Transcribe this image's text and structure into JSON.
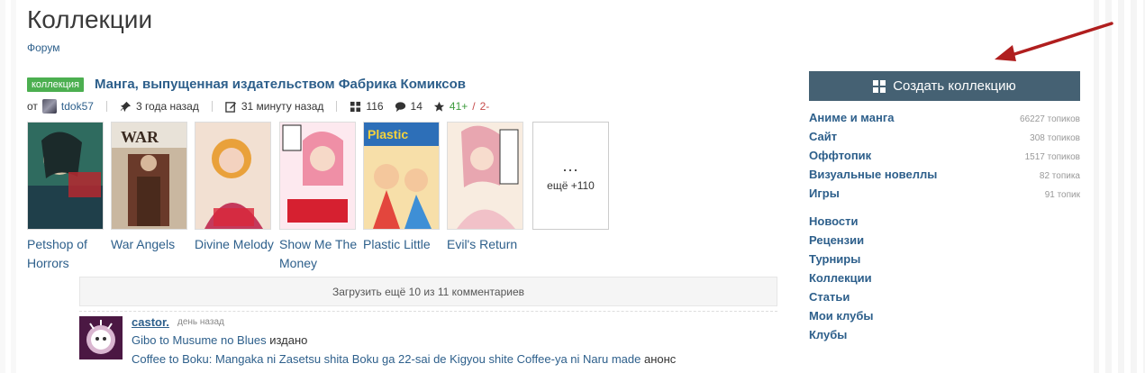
{
  "page": {
    "title": "Коллекции",
    "breadcrumb": "Форум"
  },
  "topic": {
    "tag": "коллекция",
    "title": "Манга, выпущенная издательством Фабрика Комиксов",
    "meta": {
      "by_prefix": "от",
      "author": "tdok57",
      "created": "3 года назад",
      "edited": "31 минуту назад",
      "items_count": "116",
      "comments_count": "14",
      "votes_plus": "41+",
      "votes_sep": " / ",
      "votes_minus": "2-"
    },
    "covers": [
      {
        "title": "Petshop of Horrors",
        "color": "#3a7a6a"
      },
      {
        "title": "War Angels",
        "color": "#6b4a3a"
      },
      {
        "title": "Divine Melody",
        "color": "#e39bb0"
      },
      {
        "title": "Show Me The Money",
        "color": "#f0a6b6"
      },
      {
        "title": "Plastic Little",
        "color": "#4a8fc6"
      },
      {
        "title": "Evil's Return",
        "color": "#e8c9a0"
      }
    ],
    "more": {
      "dots": "...",
      "label": "ещё +110"
    }
  },
  "comments": {
    "load_more": "Загрузить ещё 10 из 11 комментариев",
    "items": [
      {
        "author": "castor.",
        "time": "день назад",
        "line1_link": "Gibo to Musume no Blues",
        "line1_text": " издано",
        "line2_link": "Coffee to Boku: Mangaka ni Zasetsu shita Boku ga 22-sai de Kigyou shite Coffee-ya ni Naru made",
        "line2_text": " анонс"
      }
    ]
  },
  "sidebar": {
    "create_button": "Создать коллекцию",
    "sections": [
      {
        "label": "Аниме и манга",
        "count": "66227 топиков"
      },
      {
        "label": "Сайт",
        "count": "308 топиков"
      },
      {
        "label": "Оффтопик",
        "count": "1517 топиков"
      },
      {
        "label": "Визуальные новеллы",
        "count": "82 топика"
      },
      {
        "label": "Игры",
        "count": "91 топик"
      }
    ],
    "links": [
      {
        "label": "Новости"
      },
      {
        "label": "Рецензии"
      },
      {
        "label": "Турниры"
      },
      {
        "label": "Коллекции"
      },
      {
        "label": "Статьи"
      },
      {
        "label": "Мои клубы"
      },
      {
        "label": "Клубы"
      }
    ]
  },
  "colors": {
    "accent": "#2d5f8b",
    "button": "#456173",
    "tag": "#4caf50",
    "arrow": "#b01e1e"
  }
}
